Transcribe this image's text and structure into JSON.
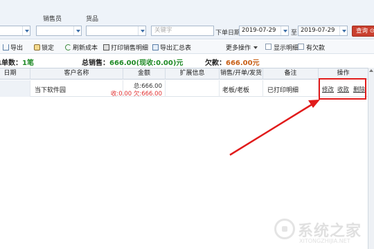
{
  "filters": {
    "salesperson_label": "销售员",
    "goods_label": "货品",
    "keyword_placeholder": "关键字",
    "order_date_label": "下单日期",
    "date_from": "2019-07-29",
    "range_sep": "至",
    "date_to": "2019-07-29",
    "query_button": "查询 ⊙"
  },
  "toolbar": {
    "export": "导出",
    "lock": "锁定",
    "refresh_cost": "刷新成本",
    "print_detail": "打印销售明细",
    "export_summary": "导出汇总表",
    "more_ops": "更多操作",
    "show_detail": "显示明细",
    "has_debt": "有欠款"
  },
  "summary": {
    "order_count_label": "总单数：",
    "order_count_value": "1笔",
    "total_sales_label": "总销售：",
    "total_sales_value": "666.00(现收:0.00)元",
    "debt_label": "欠款：",
    "debt_value": "666.00元"
  },
  "table": {
    "columns": [
      "日期",
      "客户名称",
      "金额",
      "扩展信息",
      "销售/开单/发货",
      "备注",
      "操作"
    ],
    "rows": [
      {
        "date": "",
        "customer": "当下软件园",
        "amount_total": "总:666.00",
        "amount_detail": "收:0.00 欠:666.00",
        "ext_info": "",
        "staff": "老板/老板",
        "remark": "已打印明细",
        "actions": [
          "修改",
          "收款",
          "删除"
        ]
      }
    ]
  },
  "watermark": {
    "text": "系统之家",
    "sub": "XITONGZHIJIA.NET"
  },
  "colors": {
    "accent_green": "#1f8a26",
    "accent_orange": "#c85f16",
    "highlight_red": "#e11b1b",
    "query_button": "#c9402f"
  }
}
